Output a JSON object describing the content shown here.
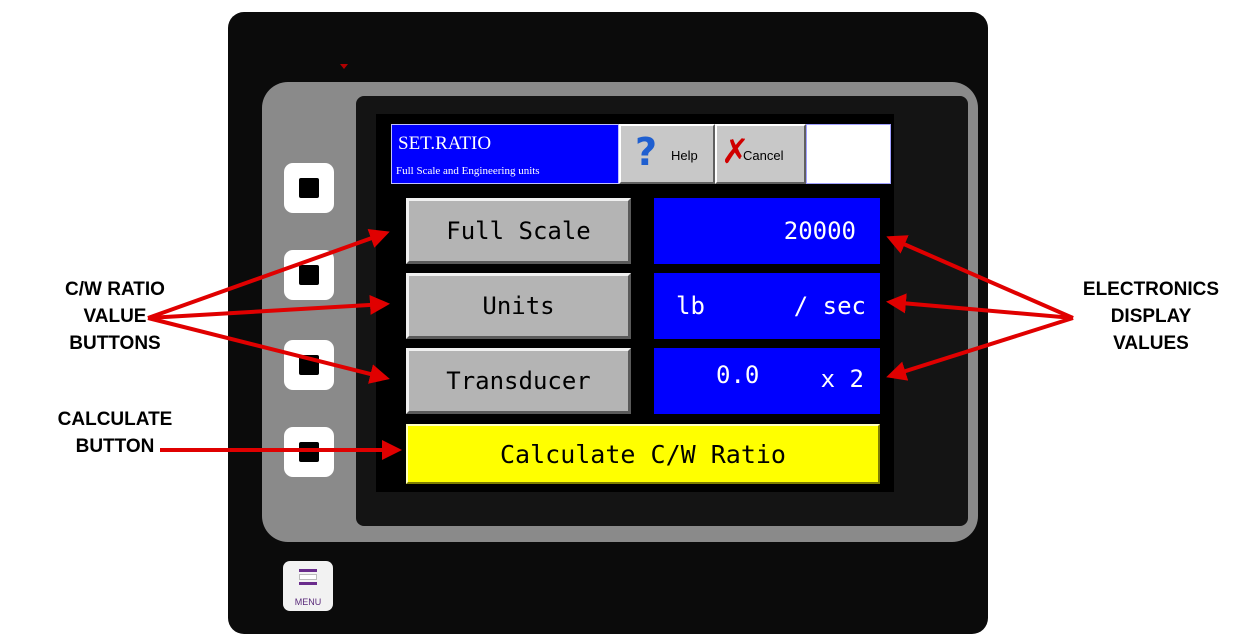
{
  "annotations": {
    "left_top": [
      "C/W RATIO",
      "VALUE",
      "BUTTONS"
    ],
    "left_bottom": [
      "CALCULATE",
      "BUTTON"
    ],
    "right": [
      "ELECTRONICS",
      "DISPLAY",
      "VALUES"
    ],
    "arrow_color": "#e00000"
  },
  "hmi": {
    "title": "SET.RATIO",
    "subtitle": "Full Scale and Engineering units",
    "help_label": "Help",
    "cancel_label": "Cancel",
    "buttons": {
      "full_scale": "Full Scale",
      "units": "Units",
      "transducer": "Transducer",
      "calculate": "Calculate C/W Ratio"
    },
    "values": {
      "full_scale": "20000",
      "units_left": "lb",
      "units_right": "/ sec",
      "transducer_left": "0.0",
      "transducer_right": "x 2"
    }
  },
  "device": {
    "menu_label": "MENU",
    "icons": [
      "help-question-icon",
      "cancel-x-icon",
      "menu-icon"
    ]
  },
  "colors": {
    "title_bg": "#0000ff",
    "value_bg": "#0000ff",
    "button_bg": "#b4b4b4",
    "calculate_bg": "#ffff00"
  }
}
